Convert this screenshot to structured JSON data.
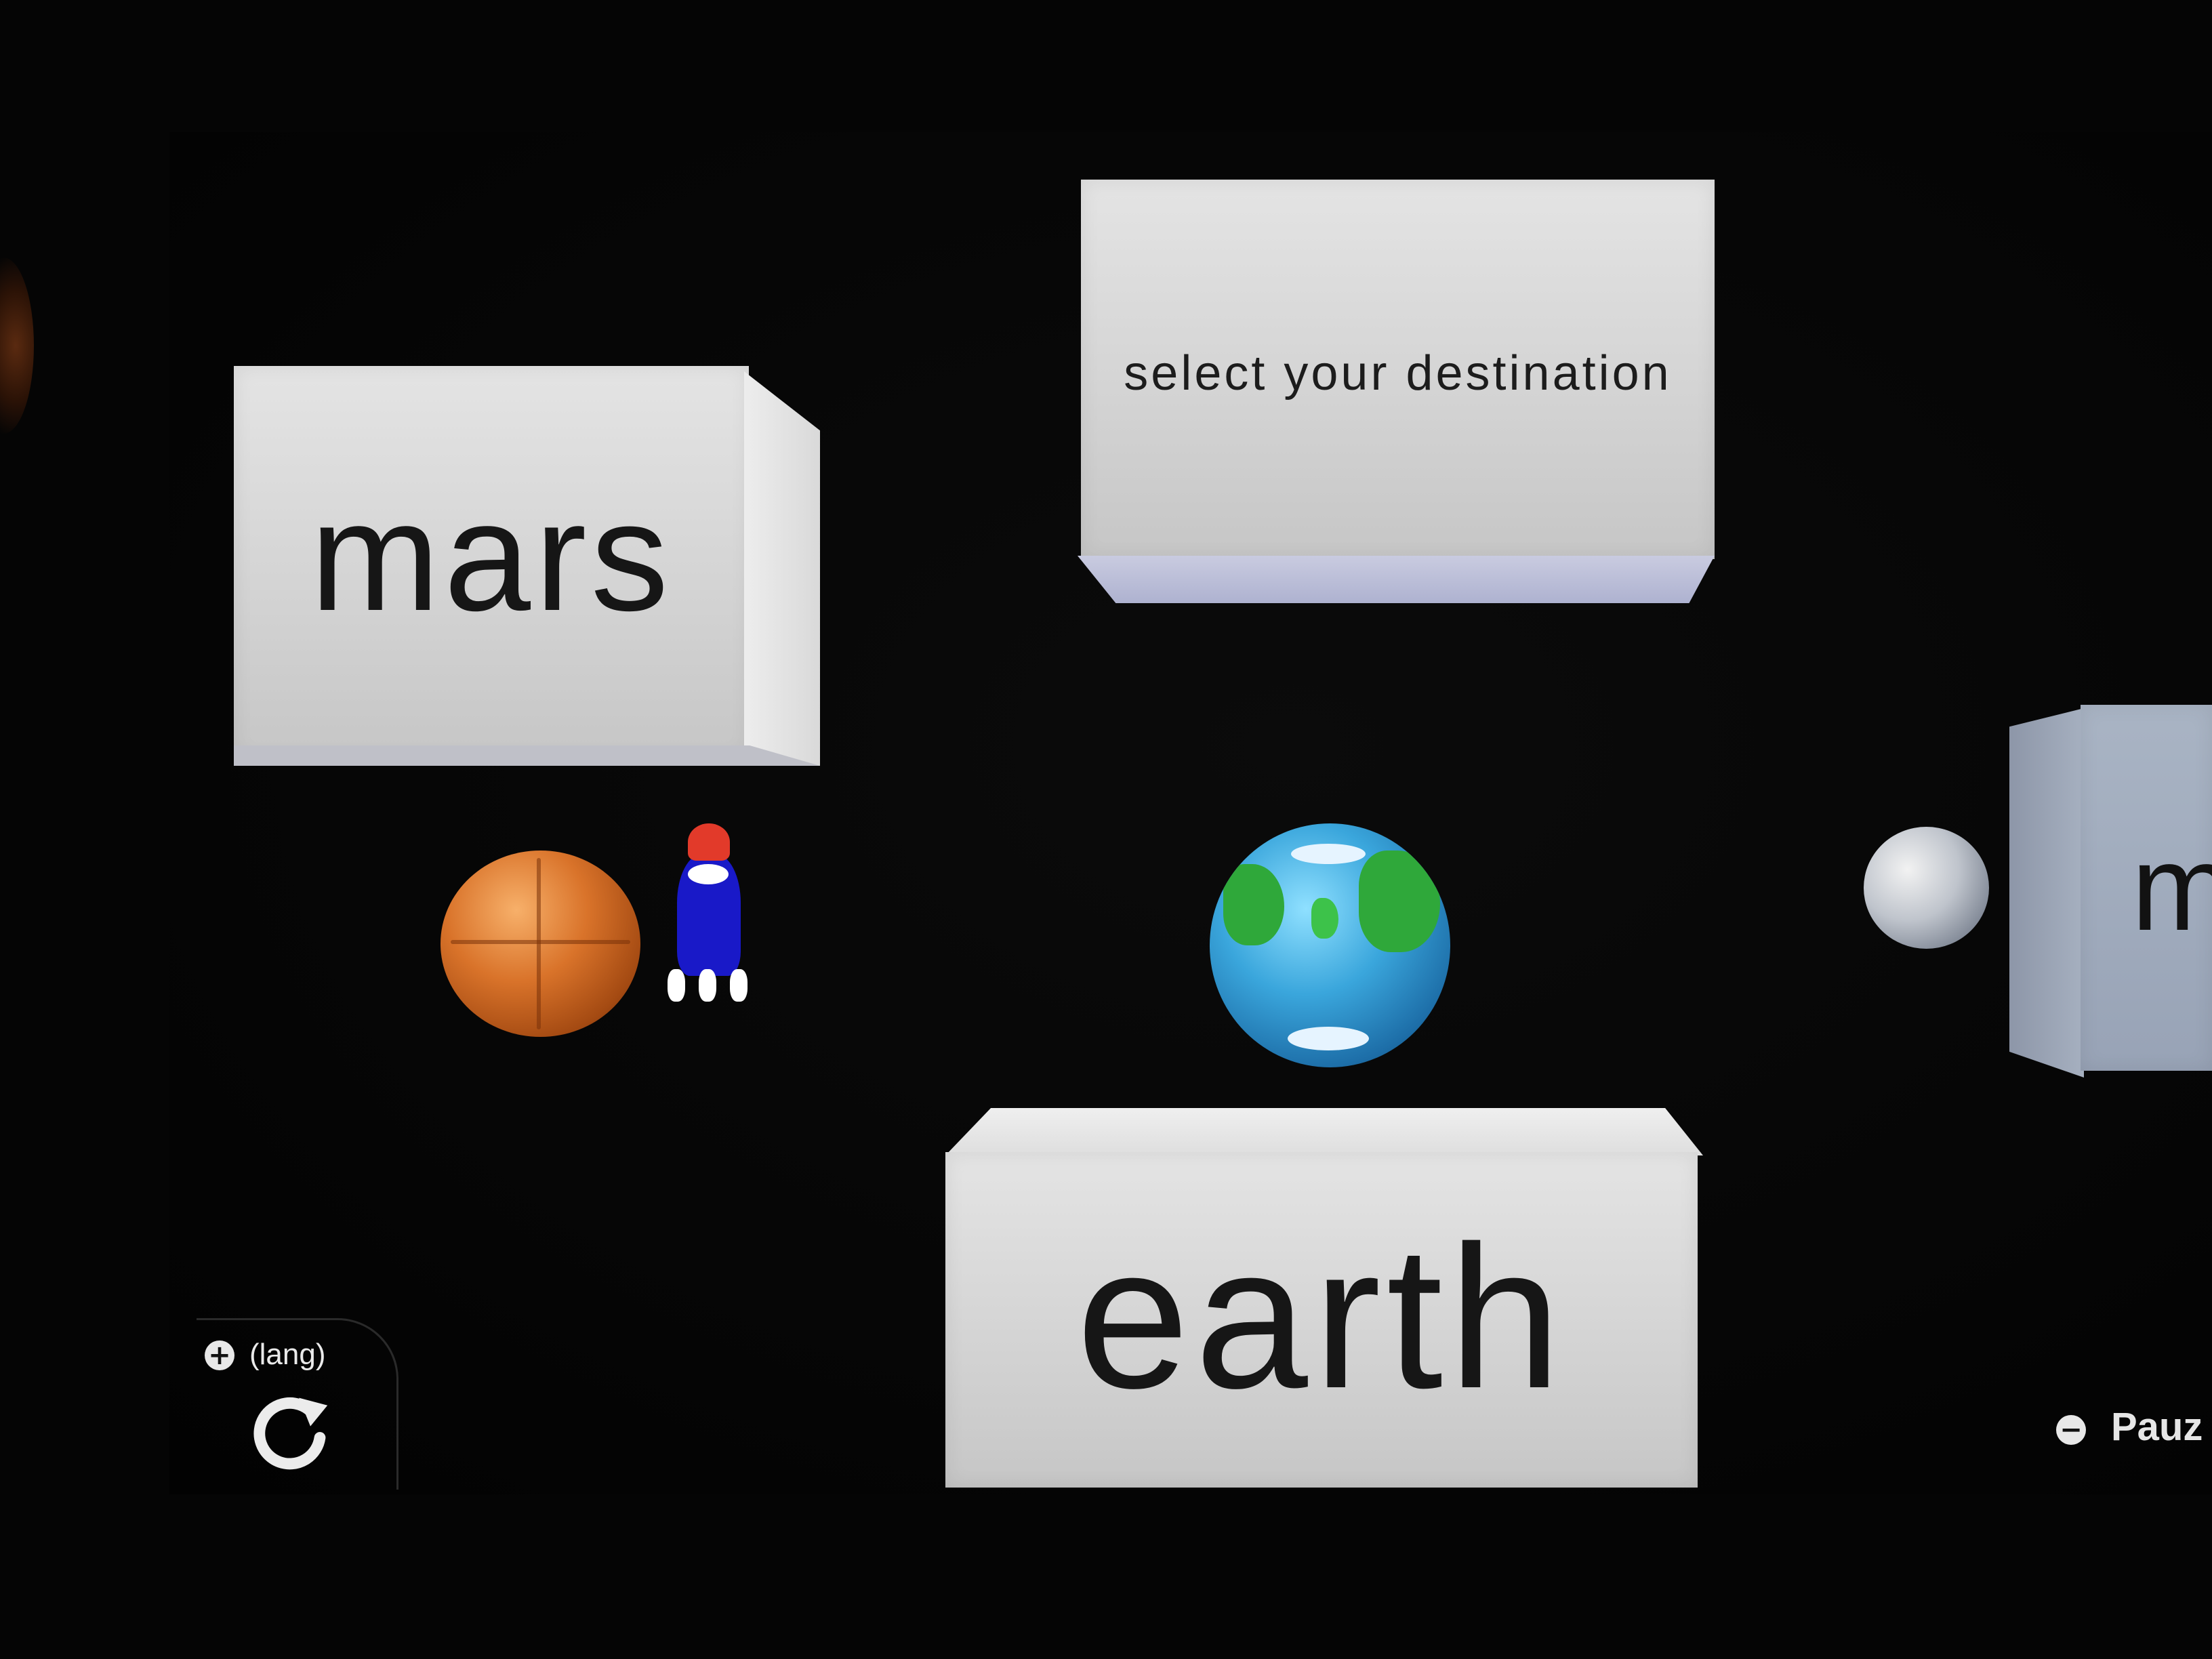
{
  "destinations": {
    "mars_label": "mars",
    "earth_label": "earth",
    "partial_label": "m"
  },
  "header": {
    "prompt": "select your destination"
  },
  "controls": {
    "lang_label": "(lang)",
    "pause_label": "Pauz",
    "plus_icon": "plus-button-icon",
    "minus_icon": "minus-button-icon",
    "refresh_icon": "refresh-icon"
  },
  "colors": {
    "background": "#050505",
    "block": "#d8d8d8",
    "mars": "#d9732a",
    "earth_ocean": "#3aa6dc",
    "earth_land": "#2fa83a",
    "rocket_body": "#1919c8",
    "rocket_nose": "#e23a2a"
  }
}
